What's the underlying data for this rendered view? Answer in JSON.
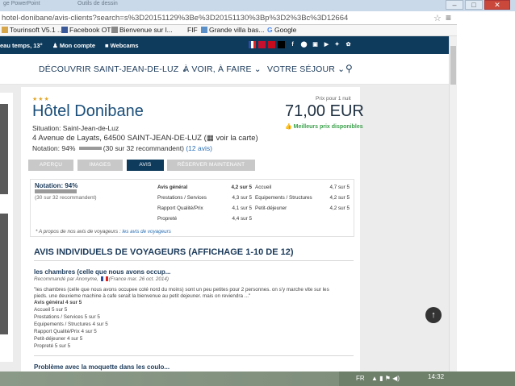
{
  "browser": {
    "tabs": [
      {
        "label": "ge PowerPoint"
      },
      {
        "label": "Outils de dessin"
      }
    ],
    "url": "hotel-donibane/avis-clients?search=s%3D20151129%3Be%3D20151130%3Bp%3D2%3Bc%3D12664",
    "star_icon": "star-icon",
    "menu_icon": "hamburger-menu-icon",
    "bookmarks": [
      {
        "label": "Tourinsoft V5.1 ..."
      },
      {
        "label": "Facebook OT"
      },
      {
        "label": "Bienvenue sur l..."
      },
      {
        "label": "FIF"
      },
      {
        "label": "Grande villa bas..."
      },
      {
        "label": "Google"
      }
    ]
  },
  "site": {
    "topbar": {
      "weather": "eau temps, 13°",
      "account": "Mon compte",
      "webcams": "Webcams"
    },
    "nav": [
      {
        "label": "DÉCOUVRIR SAINT-JEAN-DE-LUZ ⌄"
      },
      {
        "label": "À VOIR, À FAIRE ⌄"
      },
      {
        "label": "VOTRE SÉJOUR ⌄"
      }
    ]
  },
  "hotel": {
    "stars": "★★★",
    "name": "Hôtel Donibane",
    "price_label": "Prix pour 1 nuit",
    "price": "71,00 EUR",
    "best_price": "Meilleurs prix disponibles",
    "situation": "Situation: Saint-Jean-de-Luz",
    "address": "4 Avenue de Layats, 64500 SAINT-JEAN-DE-LUZ",
    "map_link": "voir la carte",
    "notation_label": "Notation:",
    "notation_pct": "94%",
    "notation_fill": 0.94,
    "notation_count": "(30 sur 32 recommandent)",
    "notation_reviews_link": "(12 avis)"
  },
  "tabs": [
    {
      "label": "APERÇU",
      "active": false
    },
    {
      "label": "IMAGES",
      "active": false
    },
    {
      "label": "AVIS",
      "active": true
    },
    {
      "label": "RÉSERVER MAINTENANT",
      "active": false
    }
  ],
  "scores": {
    "label": "Notation: 94%",
    "sub": "(30 sur 32 recommandent)",
    "left": [
      {
        "name": "Avis général",
        "value": "4,2 sur 5"
      },
      {
        "name": "Prestations / Services",
        "value": "4,3 sur 5"
      },
      {
        "name": "Rapport Qualité/Prix",
        "value": "4,1 sur 5"
      },
      {
        "name": "Propreté",
        "value": "4,4 sur 5"
      }
    ],
    "right": [
      {
        "name": "Accueil",
        "value": "4,7 sur 5"
      },
      {
        "name": "Equipements / Structures",
        "value": "4,2 sur 5"
      },
      {
        "name": "Petit-déjeuner",
        "value": "4,2 sur 5"
      }
    ],
    "apropos_prefix": "* A propos de nos avis de voyageurs :",
    "apropos_link": "les avis de voyageurs"
  },
  "reviews": {
    "heading": "AVIS INDIVIDUELS DE VOYAGEURS (AFFICHAGE 1-10 DE 12)",
    "items": [
      {
        "title": "les chambres (celle que nous avons occup...",
        "meta_prefix": "Recommandé par Anonyme,",
        "meta_suffix": "(France mar. 26 oct. 2014)",
        "body1": "\"les chambres (celle que nous avons occupee coté nord du moins) sont un peu petites pour 2 personnes. on s'y marche vite sur les",
        "body2": "pieds. une deuxieme machine à cafe serait la bienvenue au petit dejeuner. mais on reviendra ...\"",
        "lines": [
          "Avis général 4 sur 5",
          "Accueil 5 sur 5",
          "Prestations / Services 5 sur 5",
          "Equipements / Structures 4 sur 5",
          "Rapport Qualité/Prix 4 sur 5",
          "Petit-déjeuner 4 sur 5",
          "Propreté 5 sur 5"
        ]
      },
      {
        "title": "Problème avec la moquette dans les coulo..."
      }
    ]
  },
  "taskbar": {
    "lang": "FR",
    "time": "14:32"
  }
}
